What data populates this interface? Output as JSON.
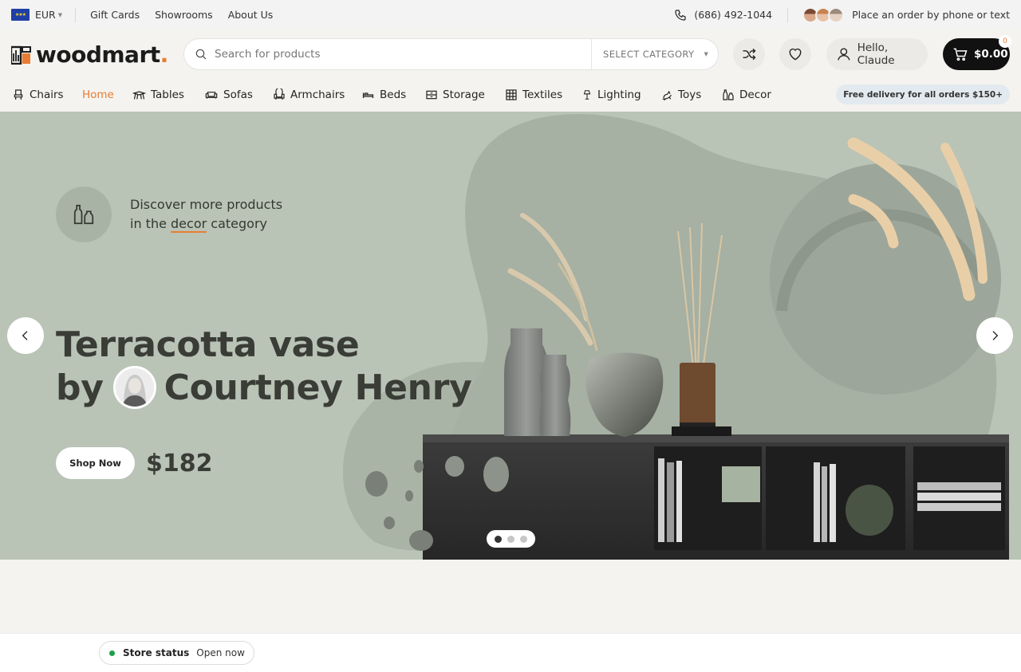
{
  "topbar": {
    "currency": "EUR",
    "links": [
      "Gift Cards",
      "Showrooms",
      "About Us"
    ],
    "phone": "(686) 492-1044",
    "order_text": "Place an order by phone or text"
  },
  "header": {
    "logo_text": "woodmart",
    "logo_dot": ".",
    "search_placeholder": "Search for products",
    "category_label": "SELECT CATEGORY",
    "account_label": "Hello, Claude",
    "cart_total": "$0.00",
    "cart_count": "0"
  },
  "nav": {
    "items": [
      {
        "label": "Chairs",
        "icon": "chair-icon"
      },
      {
        "label": "Home",
        "icon": "",
        "active": true
      },
      {
        "label": "Tables",
        "icon": "table-icon"
      },
      {
        "label": "Sofas",
        "icon": "sofa-icon"
      },
      {
        "label": "Armchairs",
        "icon": "armchair-icon"
      },
      {
        "label": "Beds",
        "icon": "bed-icon"
      },
      {
        "label": "Storage",
        "icon": "storage-icon"
      },
      {
        "label": "Textiles",
        "icon": "textiles-icon"
      },
      {
        "label": "Lighting",
        "icon": "lamp-icon"
      },
      {
        "label": "Toys",
        "icon": "toy-icon"
      },
      {
        "label": "Decor",
        "icon": "vase-icon"
      }
    ],
    "delivery_text": "Free delivery for all orders $150+"
  },
  "hero": {
    "promo_line1": "Discover more products",
    "promo_line2_pre": "in the ",
    "promo_line2_highlight": "decor",
    "promo_line2_post": " category",
    "title_line1": "Terracotta vase",
    "title_by": "by",
    "title_author": "Courtney Henry",
    "button_label": "Shop Now",
    "price": "$182",
    "slide_count": 3,
    "active_slide": 1
  },
  "store": {
    "label": "Store status",
    "value": "Open now",
    "status_color": "#1aa04a"
  },
  "colors": {
    "accent": "#e97c32",
    "hero_bg": "#b9c3b6",
    "dark": "#111111"
  }
}
